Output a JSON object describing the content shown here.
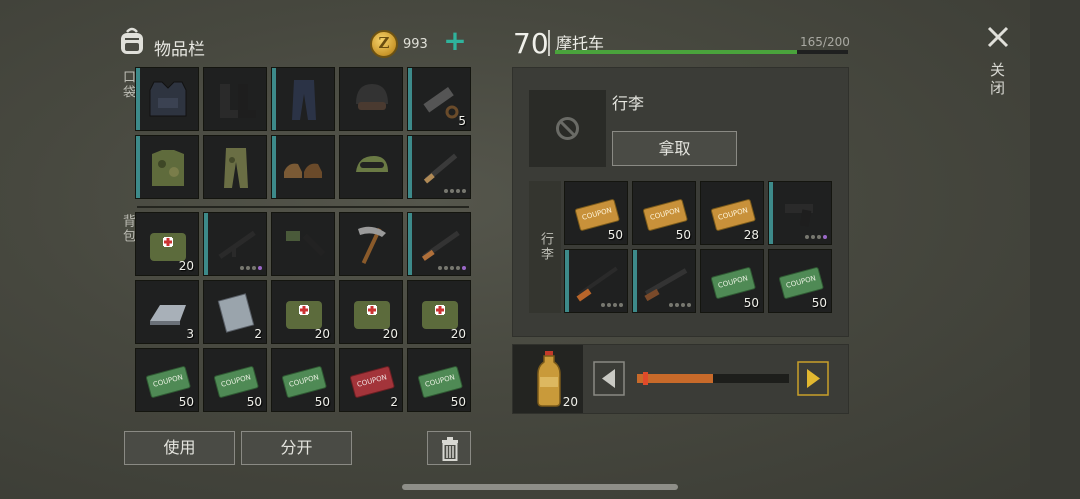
{
  "header": {
    "title": "物品栏",
    "currency": "993",
    "add_icon": "plus-icon",
    "coin_symbol": "Z"
  },
  "sections": {
    "pockets": "口袋",
    "backpack": "背包"
  },
  "pockets": [
    {
      "item": "tactical-vest",
      "qty": "",
      "dots": []
    },
    {
      "item": "boots",
      "qty": "",
      "dots": []
    },
    {
      "item": "pants",
      "qty": "",
      "dots": []
    },
    {
      "item": "helmet",
      "qty": "",
      "dots": []
    },
    {
      "item": "crafting-parts",
      "qty": "5",
      "dots": []
    },
    {
      "item": "camo-jacket",
      "qty": "",
      "dots": []
    },
    {
      "item": "camo-pants",
      "qty": "",
      "dots": []
    },
    {
      "item": "leather-shoes",
      "qty": "",
      "dots": []
    },
    {
      "item": "cap-goggles",
      "qty": "",
      "dots": []
    },
    {
      "item": "rifle",
      "qty": "",
      "dots": [
        "g",
        "g",
        "g",
        "g"
      ]
    }
  ],
  "backpack": [
    {
      "item": "medkit",
      "qty": "20",
      "dots": []
    },
    {
      "item": "assault-rifle",
      "qty": "",
      "dots": [
        "g",
        "g",
        "g",
        "p"
      ]
    },
    {
      "item": "flamethrower",
      "qty": "",
      "dots": []
    },
    {
      "item": "pickaxe",
      "qty": "",
      "dots": []
    },
    {
      "item": "ak-rifle",
      "qty": "",
      "dots": [
        "g",
        "g",
        "g",
        "g",
        "p"
      ]
    },
    {
      "item": "iron-ingot",
      "qty": "3",
      "dots": []
    },
    {
      "item": "metal-plate",
      "qty": "2",
      "dots": []
    },
    {
      "item": "medkit",
      "qty": "20",
      "dots": []
    },
    {
      "item": "medkit",
      "qty": "20",
      "dots": []
    },
    {
      "item": "medkit",
      "qty": "20",
      "dots": []
    },
    {
      "item": "ration-coupon",
      "qty": "50",
      "dots": []
    },
    {
      "item": "ration-coupon",
      "qty": "50",
      "dots": []
    },
    {
      "item": "ration-coupon",
      "qty": "50",
      "dots": []
    },
    {
      "item": "combat-coupon",
      "qty": "2",
      "dots": []
    },
    {
      "item": "ration-coupon",
      "qty": "50",
      "dots": []
    }
  ],
  "actions": {
    "use": "使用",
    "split": "分开"
  },
  "vehicle": {
    "level": "70",
    "name": "摩托车",
    "capacity": "165/200",
    "capacity_fraction": 0.825
  },
  "luggage": {
    "title": "行李",
    "take": "拿取",
    "side_label": "行李"
  },
  "luggage_items": [
    {
      "item": "ticket-coupon",
      "qty": "50",
      "dots": []
    },
    {
      "item": "ticket-coupon",
      "qty": "50",
      "dots": []
    },
    {
      "item": "ticket-coupon",
      "qty": "28",
      "dots": []
    },
    {
      "item": "pistol",
      "qty": "",
      "dots": [
        "g",
        "g",
        "g",
        "p"
      ]
    },
    {
      "item": "sniper-rifle",
      "qty": "",
      "dots": [
        "g",
        "g",
        "g",
        "g"
      ]
    },
    {
      "item": "shotgun",
      "qty": "",
      "dots": [
        "g",
        "g",
        "g",
        "g"
      ]
    },
    {
      "item": "ration-coupon",
      "qty": "50",
      "dots": []
    },
    {
      "item": "ration-coupon",
      "qty": "50",
      "dots": []
    }
  ],
  "transfer": {
    "item": "water-bottle",
    "qty": "20",
    "amount_fraction": 0.5
  },
  "close": {
    "label": "关闭"
  },
  "colors": {
    "accent": "#2fb39c",
    "capacity_bar": "#4aa33c",
    "slider_fill": "#c86a2a",
    "rarity_stripe": "#3d8a8a",
    "rarity_purple": "#9a68c8"
  }
}
